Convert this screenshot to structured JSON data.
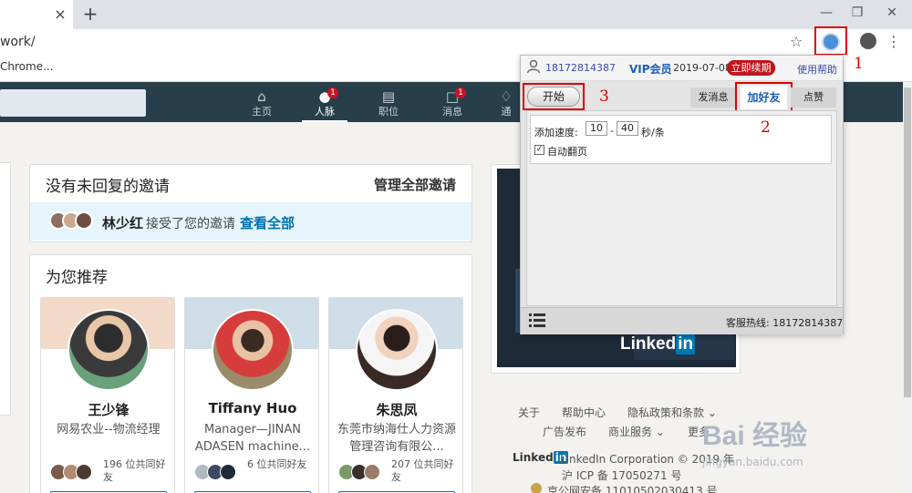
{
  "browser": {
    "url": "work/",
    "bookmark": "Chrome...",
    "tab_close": "×",
    "new_tab": "+"
  },
  "nav": {
    "items": [
      {
        "label": "主页",
        "icon": "home-icon"
      },
      {
        "label": "人脉",
        "icon": "people-icon",
        "badge": "1"
      },
      {
        "label": "职位",
        "icon": "briefcase-icon"
      },
      {
        "label": "消息",
        "icon": "chat-icon",
        "badge": "1"
      },
      {
        "label": "通",
        "icon": "bell-icon"
      }
    ]
  },
  "invitations": {
    "title": "没有未回复的邀请",
    "manage": "管理全部邀请",
    "name": "林少红",
    "text": "接受了您的邀请",
    "view_all": "查看全部"
  },
  "recommendations": {
    "title": "为您推荐",
    "people": [
      {
        "name": "王少锋",
        "title": "网易农业--物流经理",
        "mutual": "196 位共同好友"
      },
      {
        "name": "Tiffany Huo",
        "title": "Manager—JINAN ADASEN machine...",
        "mutual": "6 位共同好友"
      },
      {
        "name": "朱思凤",
        "title": "东莞市纳海仕人力资源管理咨询有限公...",
        "mutual": "207 位共同好友"
      }
    ]
  },
  "ad": {
    "logo_text": "Linked",
    "logo_in": "in"
  },
  "footer": {
    "about": "关于",
    "help": "帮助中心",
    "privacy": "隐私政策和条款",
    "ads": "广告发布",
    "business": "商业服务",
    "more": "更多",
    "brand_text": "Linked",
    "brand_in": "in",
    "copyright": "LinkedIn Corporation © 2019 年",
    "icp": "沪 ICP 备 17050271 号",
    "security": "京公网安备 11010502030413 号"
  },
  "popup": {
    "phone": "18172814387",
    "vip": "VIP会员",
    "date": "2019-07-08",
    "renew": "立即续期",
    "help": "使用帮助",
    "start": "开始",
    "tabs": {
      "send": "发消息",
      "add": "加好友",
      "like": "点赞"
    },
    "speed_label": "添加速度:",
    "speed_min": "10",
    "speed_max": "40",
    "speed_dash": "-",
    "speed_unit": "秒/条",
    "auto_page": "自动翻页",
    "hotline": "客服热线: 18172814387"
  },
  "annotations": [
    "1",
    "2",
    "3"
  ],
  "watermark": {
    "text": "Bai 经验",
    "url": "jingyan.baidu.com"
  },
  "colors": {
    "accent": "#0073b1",
    "nav_bg": "#283e4a",
    "annotation": "#dd0000",
    "renew": "#c0151b"
  }
}
